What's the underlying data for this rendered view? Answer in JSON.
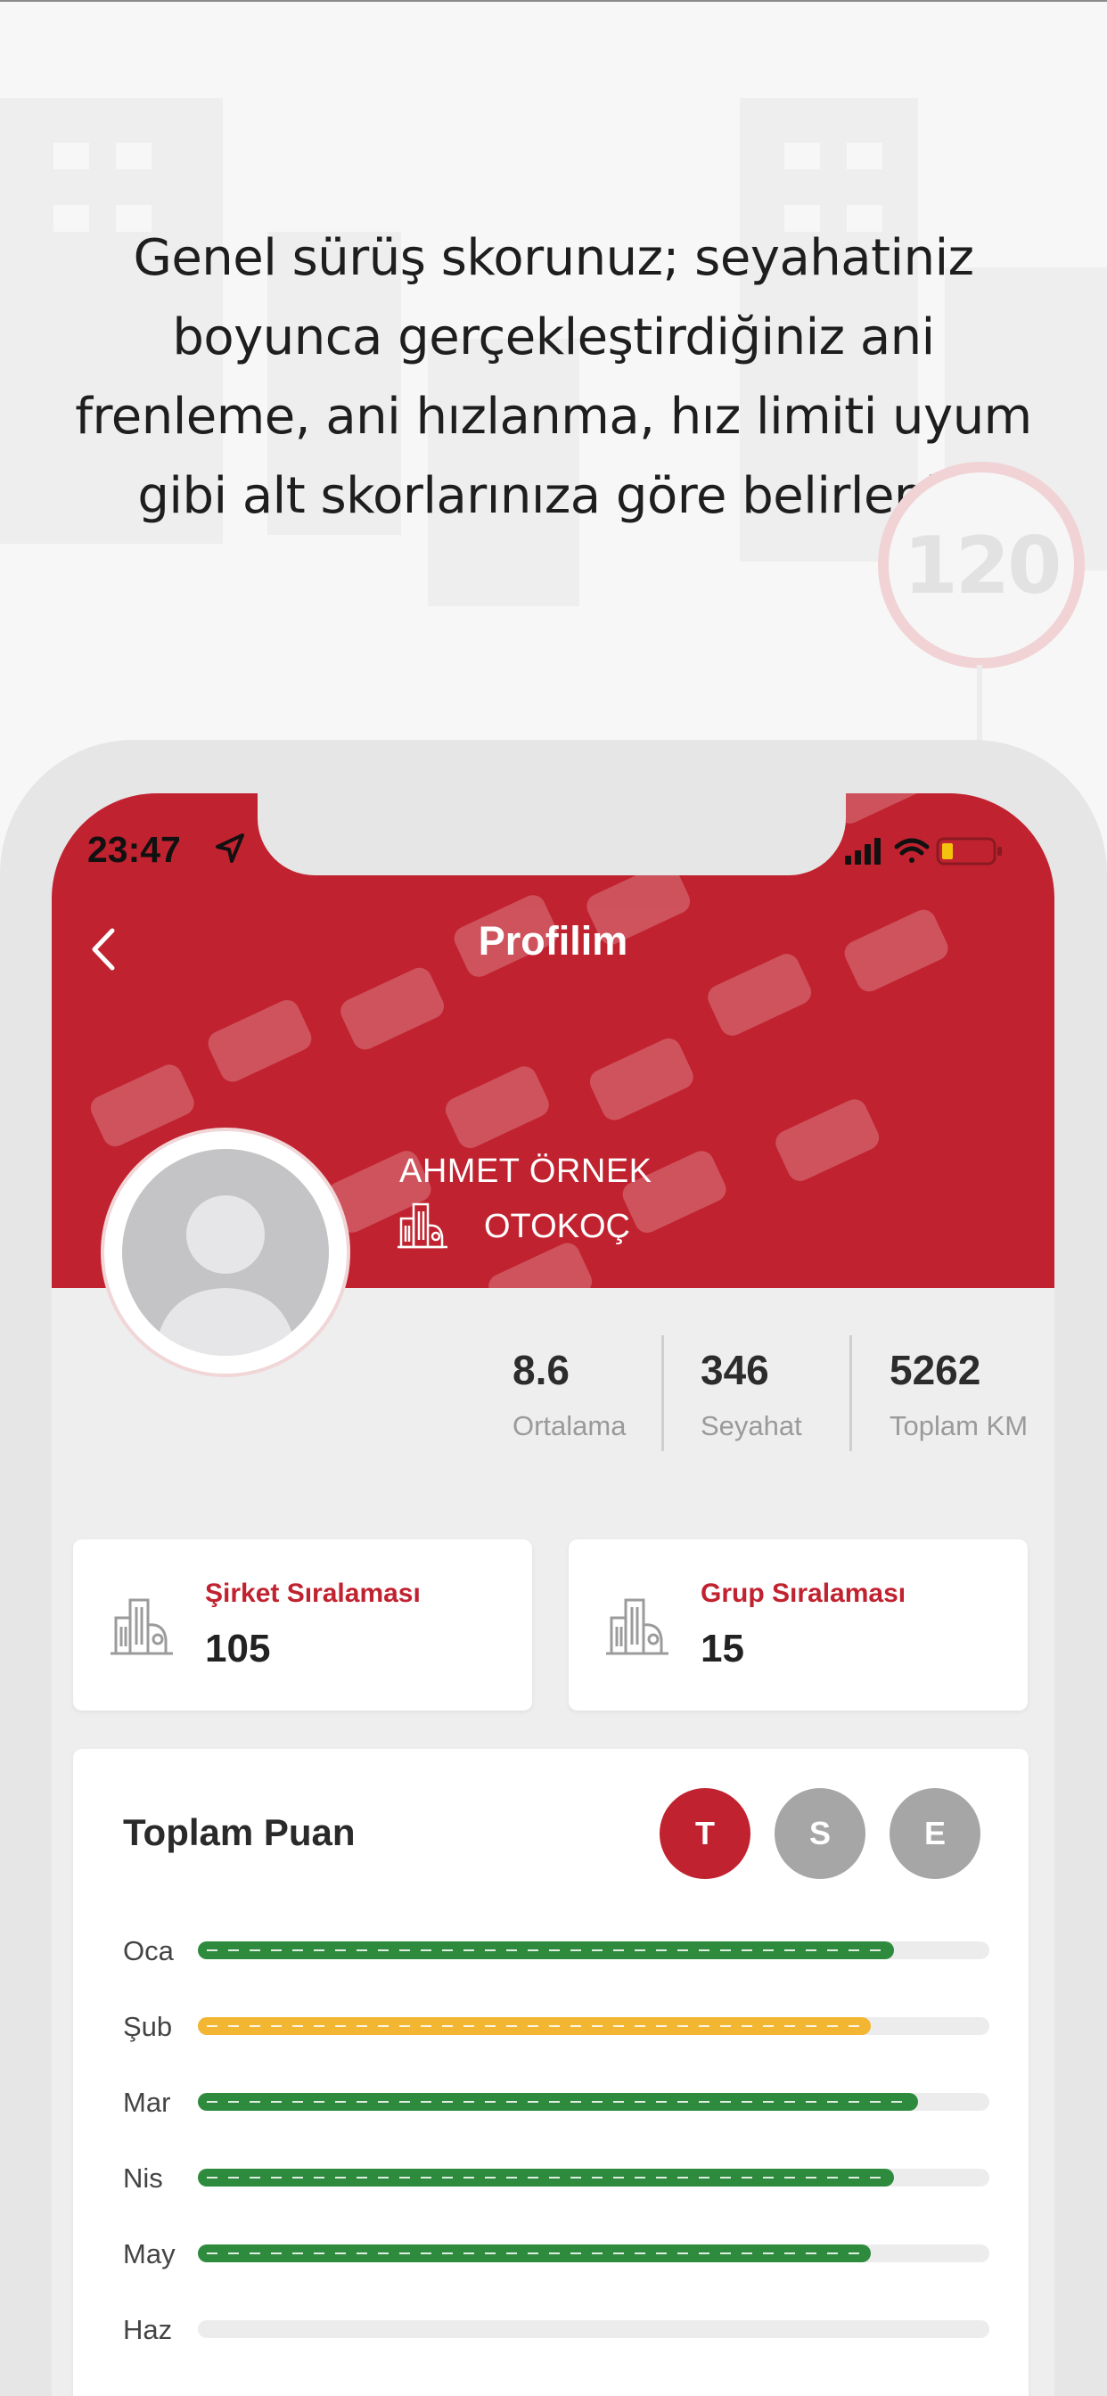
{
  "headline": "Genel sürüş skorunuz; seyahatiniz boyunca gerçekleştirdiğiniz ani frenleme, ani hızlanma, hız limiti uyum gibi alt skorlarınıza göre belirlenir.",
  "speed_sign": "120",
  "status_bar": {
    "time": "23:47"
  },
  "header": {
    "title": "Profilim",
    "back_icon": "chevron-left-icon"
  },
  "profile": {
    "name": "AHMET ÖRNEK",
    "company": "OTOKOÇ",
    "company_icon": "buildings-icon"
  },
  "stats": [
    {
      "value": "8.6",
      "label": "Ortalama"
    },
    {
      "value": "346",
      "label": "Seyahat"
    },
    {
      "value": "5262",
      "label": "Toplam KM"
    }
  ],
  "rankings": [
    {
      "title": "Şirket Sıralaması",
      "value": "105",
      "icon": "buildings-icon"
    },
    {
      "title": "Grup Sıralaması",
      "value": "15",
      "icon": "buildings-icon"
    }
  ],
  "score_card": {
    "title": "Toplam Puan",
    "filters": [
      {
        "label": "T",
        "active": true
      },
      {
        "label": "S",
        "active": false
      },
      {
        "label": "E",
        "active": false
      }
    ],
    "months": [
      {
        "label": "Oca",
        "level": 0.88,
        "color": "#2e8b3e"
      },
      {
        "label": "Şub",
        "level": 0.85,
        "color": "#f2b632"
      },
      {
        "label": "Mar",
        "level": 0.91,
        "color": "#2e8b3e"
      },
      {
        "label": "Nis",
        "level": 0.88,
        "color": "#2e8b3e"
      },
      {
        "label": "May",
        "level": 0.85,
        "color": "#2e8b3e"
      },
      {
        "label": "Haz",
        "level": 0,
        "color": "#2e8b3e"
      }
    ]
  },
  "colors": {
    "brand_red": "#c1222f",
    "inactive_pill": "#a6a6a6",
    "track": "#ececec"
  }
}
